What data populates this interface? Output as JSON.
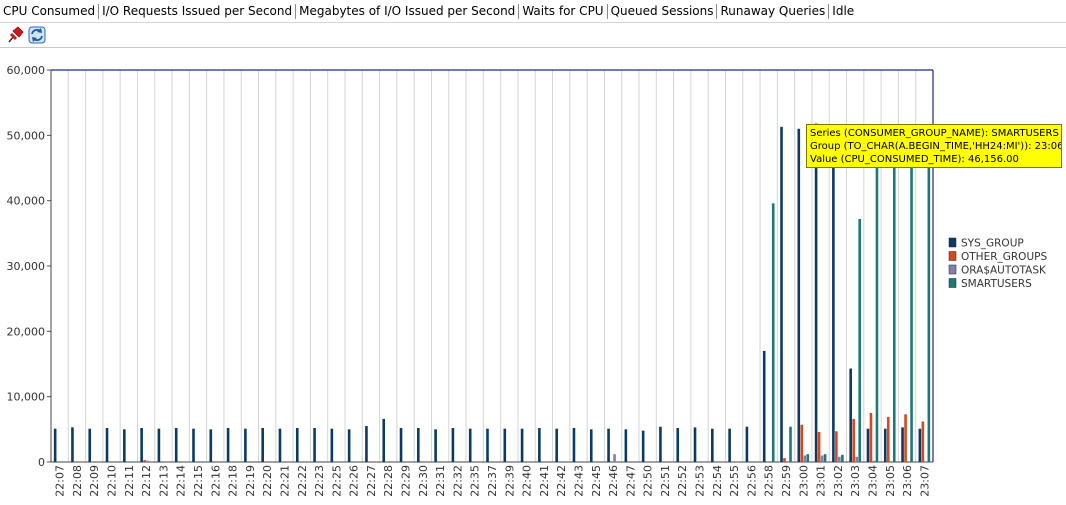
{
  "tabs": [
    {
      "label": "CPU Consumed",
      "active": true
    },
    {
      "label": "I/O Requests Issued per Second",
      "active": false
    },
    {
      "label": "Megabytes of I/O Issued per Second",
      "active": false
    },
    {
      "label": "Waits for CPU",
      "active": false
    },
    {
      "label": "Queued Sessions",
      "active": false
    },
    {
      "label": "Runaway Queries",
      "active": false
    },
    {
      "label": "Idle",
      "active": false
    }
  ],
  "toolbar": {
    "icons": [
      "pin-icon",
      "refresh-icon"
    ]
  },
  "tooltip": {
    "line1": "Series (CONSUMER_GROUP_NAME): SMARTUSERS",
    "line2": "Group (TO_CHAR(A.BEGIN_TIME,'HH24:MI')): 23:06",
    "line3": "Value (CPU_CONSUMED_TIME): 46,156.00"
  },
  "chart_data": {
    "type": "bar",
    "title": "",
    "xlabel": "",
    "ylabel": "",
    "ylim": [
      0,
      60000
    ],
    "yticks": [
      "0",
      "10,000",
      "20,000",
      "30,000",
      "40,000",
      "50,000",
      "60,000"
    ],
    "grid": true,
    "legend_position": "right",
    "categories": [
      "22:07",
      "22:08",
      "22:09",
      "22:10",
      "22:11",
      "22:12",
      "22:13",
      "22:14",
      "22:15",
      "22:16",
      "22:18",
      "22:19",
      "22:20",
      "22:21",
      "22:22",
      "22:23",
      "22:25",
      "22:26",
      "22:27",
      "22:28",
      "22:29",
      "22:30",
      "22:31",
      "22:32",
      "22:35",
      "22:37",
      "22:39",
      "22:40",
      "22:41",
      "22:42",
      "22:43",
      "22:45",
      "22:46",
      "22:47",
      "22:50",
      "22:51",
      "22:52",
      "22:53",
      "22:54",
      "22:55",
      "22:56",
      "22:58",
      "22:59",
      "23:00",
      "23:01",
      "23:02",
      "23:03",
      "23:04",
      "23:05",
      "23:06",
      "23:07"
    ],
    "series": [
      {
        "name": "SYS_GROUP",
        "color": "#0b3a66",
        "values": [
          5100,
          5300,
          5100,
          5200,
          5000,
          5200,
          5100,
          5200,
          5100,
          5000,
          5200,
          5100,
          5200,
          5100,
          5200,
          5200,
          5100,
          5000,
          5500,
          6600,
          5200,
          5200,
          5000,
          5200,
          5100,
          5100,
          5100,
          5100,
          5200,
          5100,
          5200,
          5000,
          5100,
          5000,
          4800,
          5400,
          5200,
          5300,
          5100,
          5100,
          5400,
          17000,
          51300,
          51000,
          51800,
          51700,
          14300,
          5100,
          5100,
          5300,
          5100
        ]
      },
      {
        "name": "OTHER_GROUPS",
        "color": "#d9471e",
        "values": [
          0,
          0,
          0,
          0,
          0,
          300,
          0,
          0,
          0,
          0,
          0,
          0,
          0,
          0,
          0,
          0,
          0,
          0,
          0,
          0,
          0,
          0,
          0,
          0,
          0,
          0,
          0,
          0,
          0,
          0,
          0,
          0,
          0,
          0,
          0,
          0,
          0,
          0,
          0,
          0,
          0,
          0,
          600,
          5700,
          4600,
          4700,
          6600,
          7500,
          6900,
          7300,
          6200
        ]
      },
      {
        "name": "ORA$AUTOTASK",
        "color": "#7f7fb0",
        "values": [
          0,
          0,
          0,
          0,
          0,
          200,
          0,
          0,
          0,
          0,
          0,
          0,
          0,
          0,
          0,
          0,
          0,
          0,
          0,
          0,
          0,
          0,
          0,
          0,
          0,
          0,
          0,
          0,
          0,
          0,
          0,
          0,
          1200,
          0,
          0,
          0,
          0,
          0,
          0,
          0,
          0,
          0,
          0,
          1000,
          1000,
          800,
          800,
          200,
          0,
          0,
          0
        ]
      },
      {
        "name": "SMARTUSERS",
        "color": "#1a7a78",
        "values": [
          0,
          0,
          0,
          0,
          0,
          0,
          0,
          0,
          0,
          0,
          0,
          0,
          0,
          0,
          0,
          0,
          0,
          0,
          0,
          0,
          0,
          0,
          0,
          0,
          0,
          0,
          0,
          0,
          0,
          0,
          0,
          0,
          0,
          0,
          0,
          0,
          0,
          0,
          0,
          0,
          0,
          39600,
          5400,
          1200,
          1200,
          1100,
          37200,
          46000,
          46000,
          46156,
          46000
        ]
      }
    ]
  }
}
